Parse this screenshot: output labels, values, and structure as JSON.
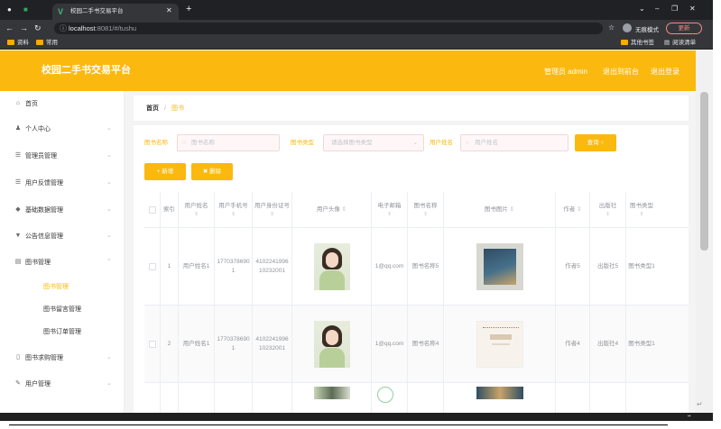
{
  "browser": {
    "tab_title": "校园二手书交易平台",
    "url_host": "localhost",
    "url_path": ":8081/#/tushu",
    "incognito_label": "无痕模式",
    "update_label": "更新",
    "bookmarks": [
      "资料",
      "常用"
    ],
    "bookmarks_right": [
      "其他书签",
      "阅读清单"
    ]
  },
  "header": {
    "title": "校园二手书交易平台",
    "admin_label": "管理员 admin",
    "back_to_front": "退出到前台",
    "logout": "退出登录"
  },
  "sidebar": {
    "items": [
      {
        "label": "首页",
        "icon": "home-icon",
        "has_chevron": false
      },
      {
        "label": "个人中心",
        "icon": "user-icon",
        "has_chevron": true
      },
      {
        "label": "管理员管理",
        "icon": "list-icon",
        "has_chevron": true
      },
      {
        "label": "用户反馈管理",
        "icon": "list-icon",
        "has_chevron": true
      },
      {
        "label": "基础数据管理",
        "icon": "data-icon",
        "has_chevron": true
      },
      {
        "label": "公告信息管理",
        "icon": "notice-icon",
        "has_chevron": true
      },
      {
        "label": "图书管理",
        "icon": "book-icon",
        "has_chevron": true,
        "expanded": true
      },
      {
        "label": "图书求购管理",
        "icon": "cart-icon",
        "has_chevron": true
      },
      {
        "label": "用户管理",
        "icon": "users-icon",
        "has_chevron": true
      }
    ],
    "sub_items": [
      {
        "label": "图书管理",
        "active": true
      },
      {
        "label": "图书留言管理",
        "active": false
      },
      {
        "label": "图书订单管理",
        "active": false
      }
    ]
  },
  "breadcrumb": {
    "home": "首页",
    "separator": "/",
    "current": "图书"
  },
  "filters": {
    "book_name_label": "图书名称",
    "book_name_placeholder": "图书名称",
    "book_type_label": "图书类型",
    "book_type_placeholder": "请选择图书类型",
    "user_name_label": "用户姓名",
    "user_name_placeholder": "用户姓名",
    "search_button": "查询",
    "add_button": "新增",
    "delete_button": "删除"
  },
  "table": {
    "columns": [
      "",
      "索引",
      "用户姓名",
      "用户手机号",
      "用户身份证号",
      "用户头像",
      "电子邮箱",
      "图书名称",
      "图书图片",
      "作者",
      "出版社",
      "图书类型"
    ],
    "rows": [
      {
        "index": "1",
        "user_name": "用户姓名1",
        "phone": "17703786901",
        "id_card": "410224199610232001",
        "email": "1@qq.com",
        "book_name": "图书名称5",
        "author": "作者5",
        "publisher": "出版社5",
        "book_type": "图书类型1"
      },
      {
        "index": "2",
        "user_name": "用户姓名1",
        "phone": "17703786901",
        "id_card": "410224199610232001",
        "email": "1@qq.com",
        "book_name": "图书名称4",
        "author": "作者4",
        "publisher": "出版社4",
        "book_type": "图书类型1"
      }
    ]
  },
  "colors": {
    "accent": "#fbb80f",
    "header_bg": "#fbb80f"
  }
}
